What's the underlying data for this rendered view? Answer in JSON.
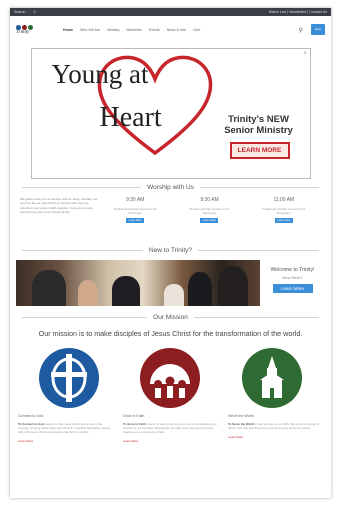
{
  "topbar": {
    "left": "Search ...",
    "right": "Watch Live | Newsletter | Contact Us"
  },
  "logo": {
    "text": "Trinity"
  },
  "nav": [
    "Home",
    "Who We Are",
    "Ministry",
    "Ministries",
    "Events",
    "News & Info",
    "Give"
  ],
  "donate_label": "Give",
  "banner": {
    "line1": "Young at",
    "line2": "Heart",
    "tagline1": "Trinity's NEW",
    "tagline2": "Senior Ministry",
    "cta": "LEARN MORE",
    "close": "x"
  },
  "worship": {
    "heading": "Worship with Us",
    "intro": "We gladly invite you to worship with us. Every Sunday, our services are an opportunity to connect with God, be refreshed, and grow in faith together. Come as you are and become part of our church family.",
    "services": [
      {
        "time": "9:30 AM",
        "desc": "Traditional worship service in the Sanctuary",
        "button": "Learn More"
      },
      {
        "time": "9:30 AM",
        "desc": "Modern worship service in the Sanctuary",
        "button": "Learn More"
      },
      {
        "time": "11:00 AM",
        "desc": "Traditional worship service in the Sanctuary",
        "button": "Learn More"
      }
    ]
  },
  "new": {
    "heading": "New to Trinity?",
    "welcome": "Welcome to Trinity!",
    "sub": "New Here?",
    "button": "Learn More"
  },
  "mission": {
    "heading": "Our Mission",
    "statement": "Our mission is to make disciples of Jesus Christ for the transformation of the world.",
    "columns": [
      {
        "title": "Connect to God",
        "lead": "To Connect to God",
        "text": "means to draw close to Him and to live in the ongoing, ongoing relationship with Christ in a spiritual fellowship, having faith with Jesus Christ and practice that faith in worship.",
        "link": "Learn More",
        "color": "#1e5aa0"
      },
      {
        "title": "Grow in Faith",
        "lead": "To Grow in Faith",
        "text": "means for each of us to grow in our understanding and practice of our Christian discipleship, through study and growing closer together as a community of faith.",
        "link": "Learn More",
        "color": "#8c1d21"
      },
      {
        "title": "Serve the World",
        "lead": "To Serve the World",
        "text": "is how we live out our faith. We serve by caring for others, the sick, and the poor in our community and in the world.",
        "link": "Learn More",
        "color": "#2e6b34"
      }
    ]
  }
}
